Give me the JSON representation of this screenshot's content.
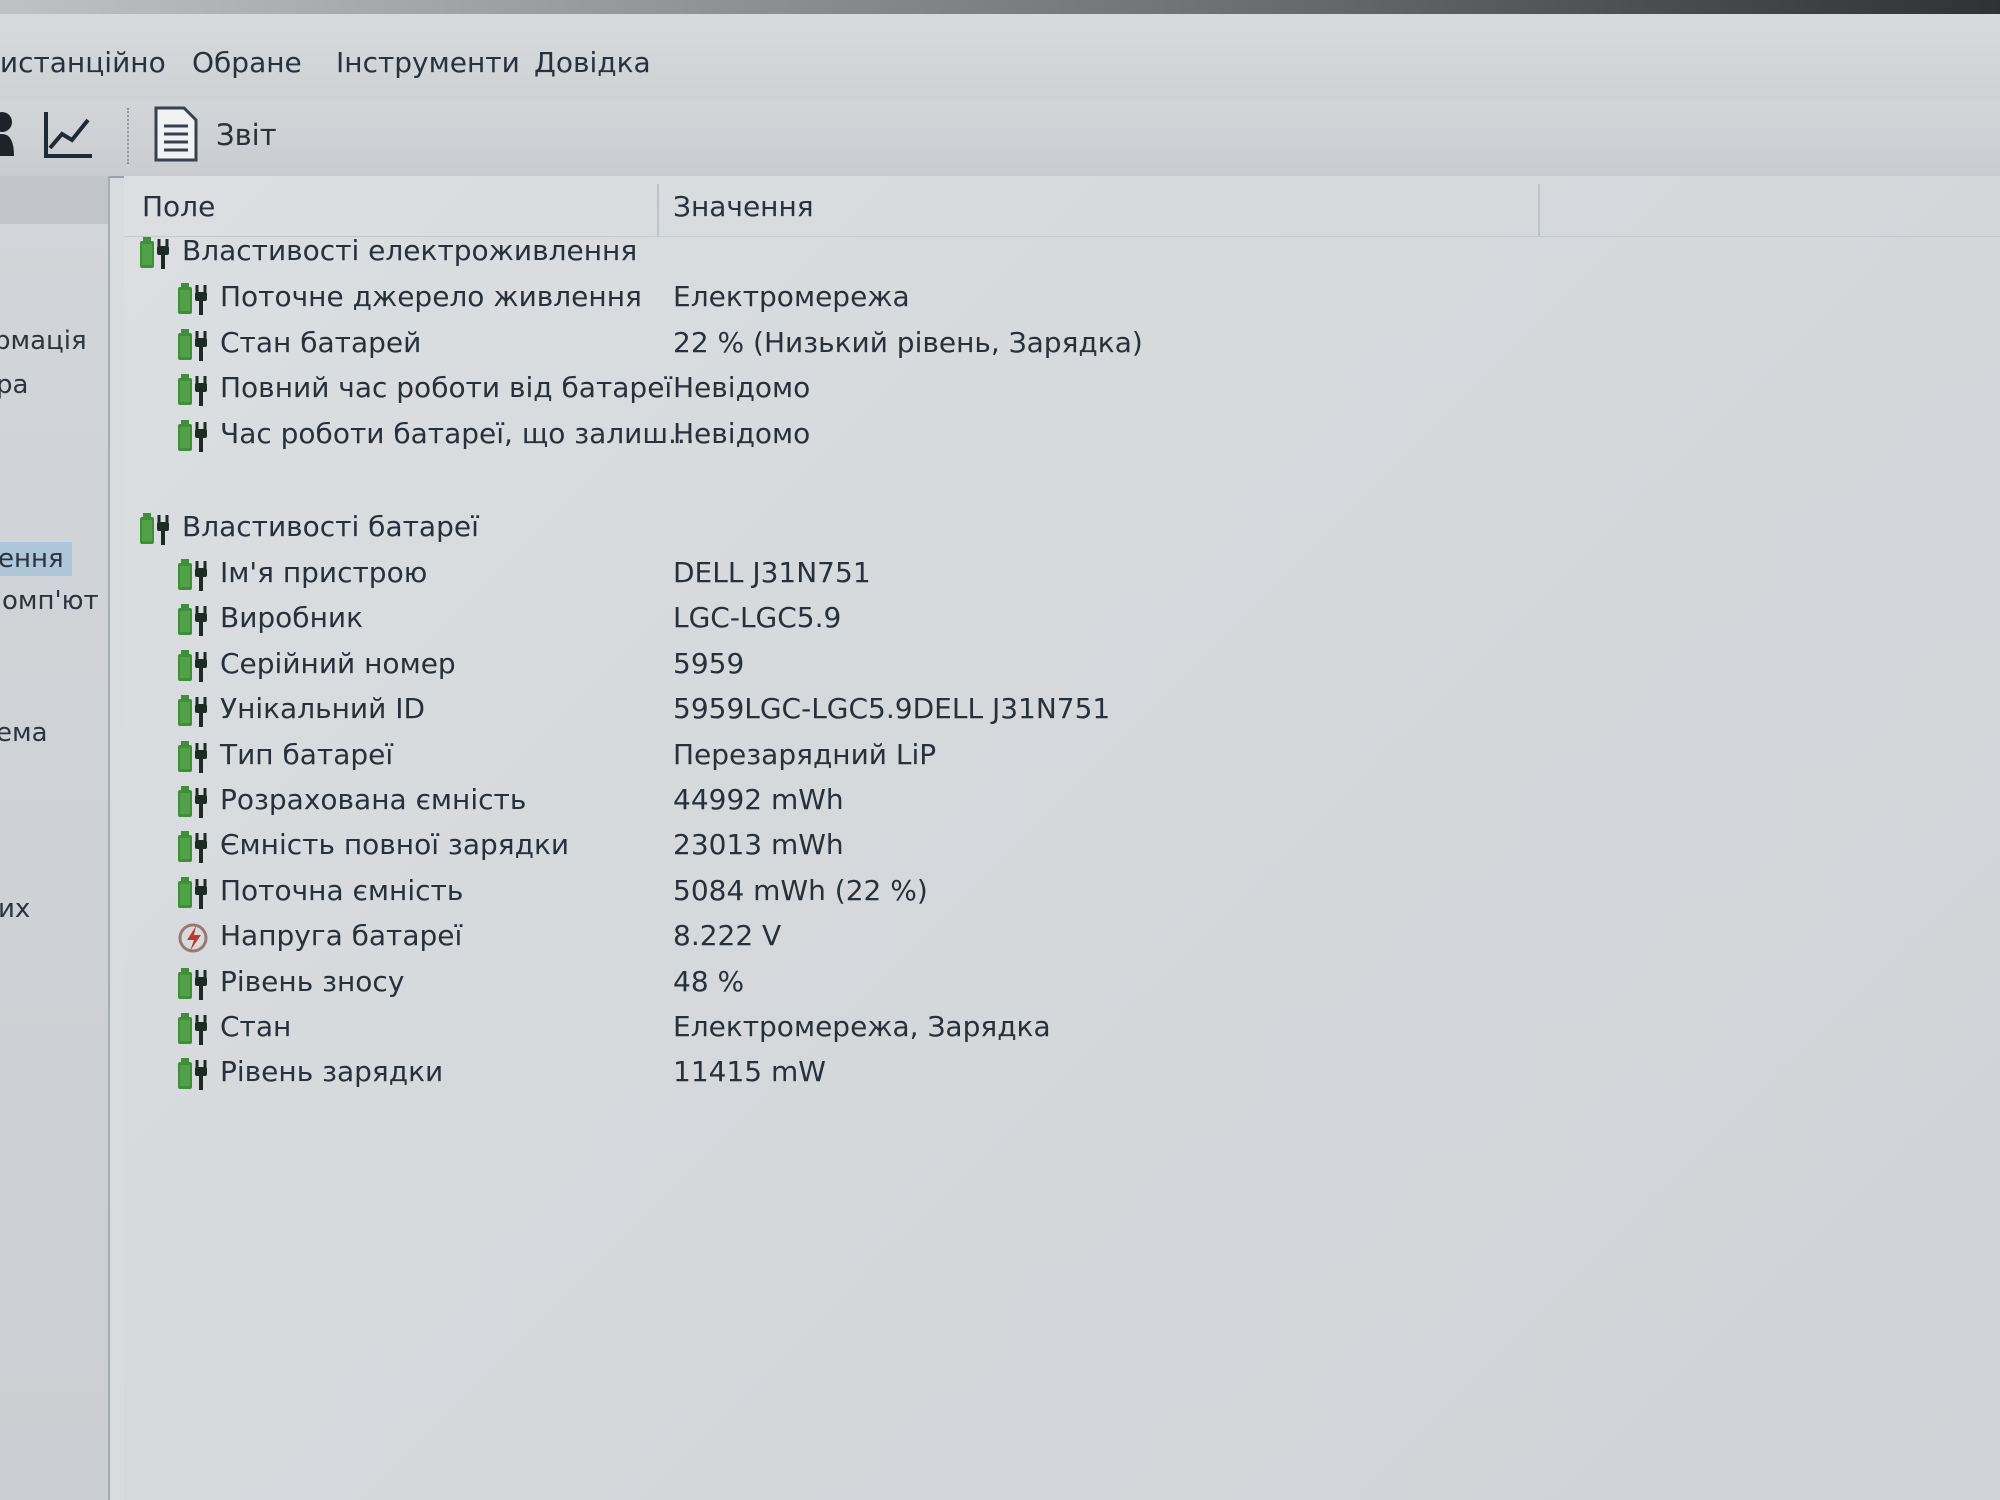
{
  "menu": {
    "item_remote": "Дистанційно",
    "item_favorites": "Обране",
    "item_tools": "Інструменти",
    "item_help": "Довідка"
  },
  "toolbar": {
    "report_label": "Звіт"
  },
  "sidebar": {
    "items": [
      "рмація",
      "ра",
      "ення",
      "омп'ют",
      "ема",
      "их"
    ]
  },
  "table": {
    "col_field": "Поле",
    "col_value": "Значення",
    "power_group": "Властивості електроживлення",
    "power_rows": [
      {
        "field": "Поточне джерело живлення",
        "value": "Електромережа",
        "icon": "battery-plug-icon"
      },
      {
        "field": "Стан батарей",
        "value": "22 % (Низький рівень, Зарядка)",
        "icon": "battery-plug-icon"
      },
      {
        "field": "Повний час роботи від батареї",
        "value": "Невідомо",
        "icon": "battery-plug-icon"
      },
      {
        "field": "Час роботи батареї, що залиш...",
        "value": "Невідомо",
        "icon": "battery-plug-icon"
      }
    ],
    "battery_group": "Властивості батареї",
    "battery_rows": [
      {
        "field": "Ім'я пристрою",
        "value": "DELL J31N751",
        "icon": "battery-plug-icon"
      },
      {
        "field": "Виробник",
        "value": "LGC-LGC5.9",
        "icon": "battery-plug-icon"
      },
      {
        "field": "Серійний номер",
        "value": "5959",
        "icon": "battery-plug-icon"
      },
      {
        "field": "Унікальний ID",
        "value": "5959LGC-LGC5.9DELL J31N751",
        "icon": "battery-plug-icon"
      },
      {
        "field": "Тип батареї",
        "value": "Перезарядний LiP",
        "icon": "battery-plug-icon"
      },
      {
        "field": "Розрахована ємність",
        "value": "44992 mWh",
        "icon": "battery-plug-icon"
      },
      {
        "field": "Ємність повної зарядки",
        "value": "23013 mWh",
        "icon": "battery-plug-icon"
      },
      {
        "field": "Поточна ємність",
        "value": "5084 mWh  (22 %)",
        "icon": "battery-plug-icon"
      },
      {
        "field": "Напруга батареї",
        "value": "8.222 V",
        "icon": "voltage-icon"
      },
      {
        "field": "Рівень зносу",
        "value": "48 %",
        "icon": "battery-plug-icon"
      },
      {
        "field": "Стан",
        "value": "Електромережа, Зарядка",
        "icon": "battery-plug-icon"
      },
      {
        "field": "Рівень зарядки",
        "value": "11415 mW",
        "icon": "battery-plug-icon"
      }
    ]
  },
  "colors": {
    "battery_green": "#3f8f3a",
    "plug_dark": "#1e2a24",
    "selection": "#aec6da"
  }
}
